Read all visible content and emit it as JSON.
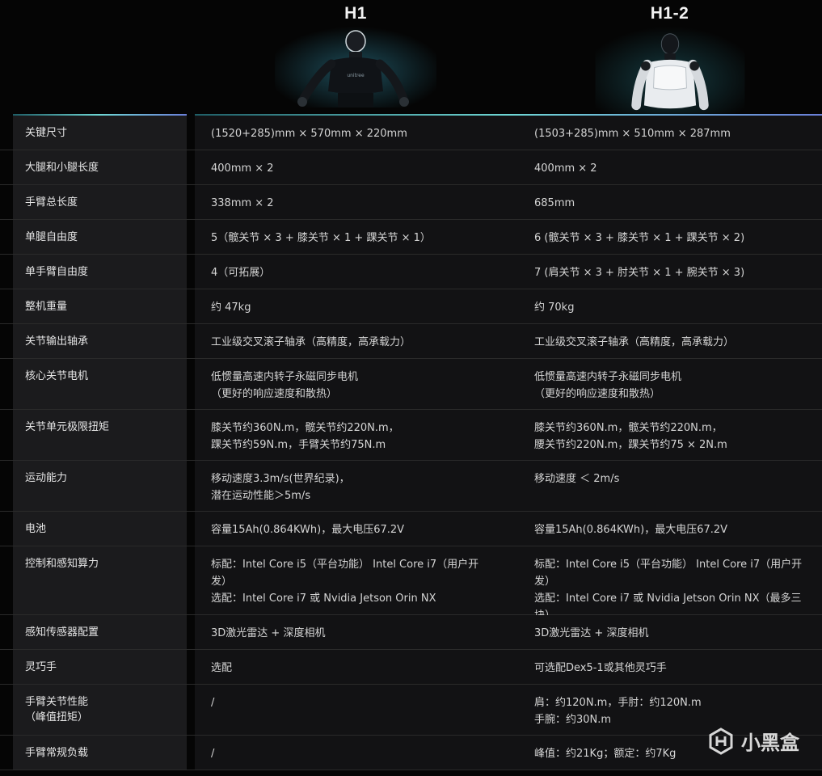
{
  "models": [
    {
      "name": "H1"
    },
    {
      "name": "H1-2"
    }
  ],
  "rows": [
    {
      "label": "关键尺寸",
      "h1": "(1520+285)mm × 570mm × 220mm",
      "h12": "(1503+285)mm × 510mm × 287mm"
    },
    {
      "label": "大腿和小腿长度",
      "h1": "400mm × 2",
      "h12": "400mm × 2"
    },
    {
      "label": "手臂总长度",
      "h1": "338mm × 2",
      "h12": "685mm"
    },
    {
      "label": "单腿自由度",
      "h1": "5（髋关节 × 3 + 膝关节 × 1 + 踝关节 × 1）",
      "h12": "6 (髋关节 × 3 + 膝关节 × 1 + 踝关节 × 2)"
    },
    {
      "label": "单手臂自由度",
      "h1": "4（可拓展）",
      "h12": "7 (肩关节 × 3 + 肘关节 × 1 + 腕关节 × 3)"
    },
    {
      "label": "整机重量",
      "h1": "约 47kg",
      "h12": "约 70kg"
    },
    {
      "label": "关节输出轴承",
      "h1": "工业级交叉滚子轴承（高精度，高承载力）",
      "h12": "工业级交叉滚子轴承（高精度，高承载力）"
    },
    {
      "label": "核心关节电机",
      "h1": "低惯量高速内转子永磁同步电机\n（更好的响应速度和散热）",
      "h12": "低惯量高速内转子永磁同步电机\n（更好的响应速度和散热）"
    },
    {
      "label": "关节单元极限扭矩",
      "h1": "膝关节约360N.m，髋关节约220N.m，\n踝关节约59N.m，手臂关节约75N.m",
      "h12": "膝关节约360N.m，髋关节约220N.m，\n腰关节约220N.m，踝关节约75 × 2N.m"
    },
    {
      "label": "运动能力",
      "h1": "移动速度3.3m/s(世界纪录)，\n潜在运动性能＞5m/s",
      "h12": "移动速度 ＜ 2m/s"
    },
    {
      "label": "电池",
      "h1": "容量15Ah(0.864KWh)，最大电压67.2V",
      "h12": "容量15Ah(0.864KWh)，最大电压67.2V"
    },
    {
      "label": "控制和感知算力",
      "h1": "标配：Intel Core i5（平台功能） Intel Core i7（用户开\n发）\n选配：Intel Core i7 或 Nvidia Jetson Orin NX",
      "h12": "标配：Intel Core i5（平台功能） Intel Core i7（用户开\n发）\n选配：Intel Core i7 或 Nvidia Jetson Orin NX（最多三\n块）"
    },
    {
      "label": "感知传感器配置",
      "h1": "3D激光雷达 + 深度相机",
      "h12": "3D激光雷达 + 深度相机"
    },
    {
      "label": "灵巧手",
      "h1": "选配",
      "h12": "可选配Dex5-1或其他灵巧手"
    },
    {
      "label": "手臂关节性能\n（峰值扭矩）",
      "h1": "/",
      "h12": "肩：约120N.m，手肘：约120N.m\n手腕：约30N.m"
    },
    {
      "label": "手臂常规负载",
      "h1": "/",
      "h12": "峰值：约21Kg；额定：约7Kg"
    }
  ],
  "watermark": {
    "text": "小黑盒"
  }
}
